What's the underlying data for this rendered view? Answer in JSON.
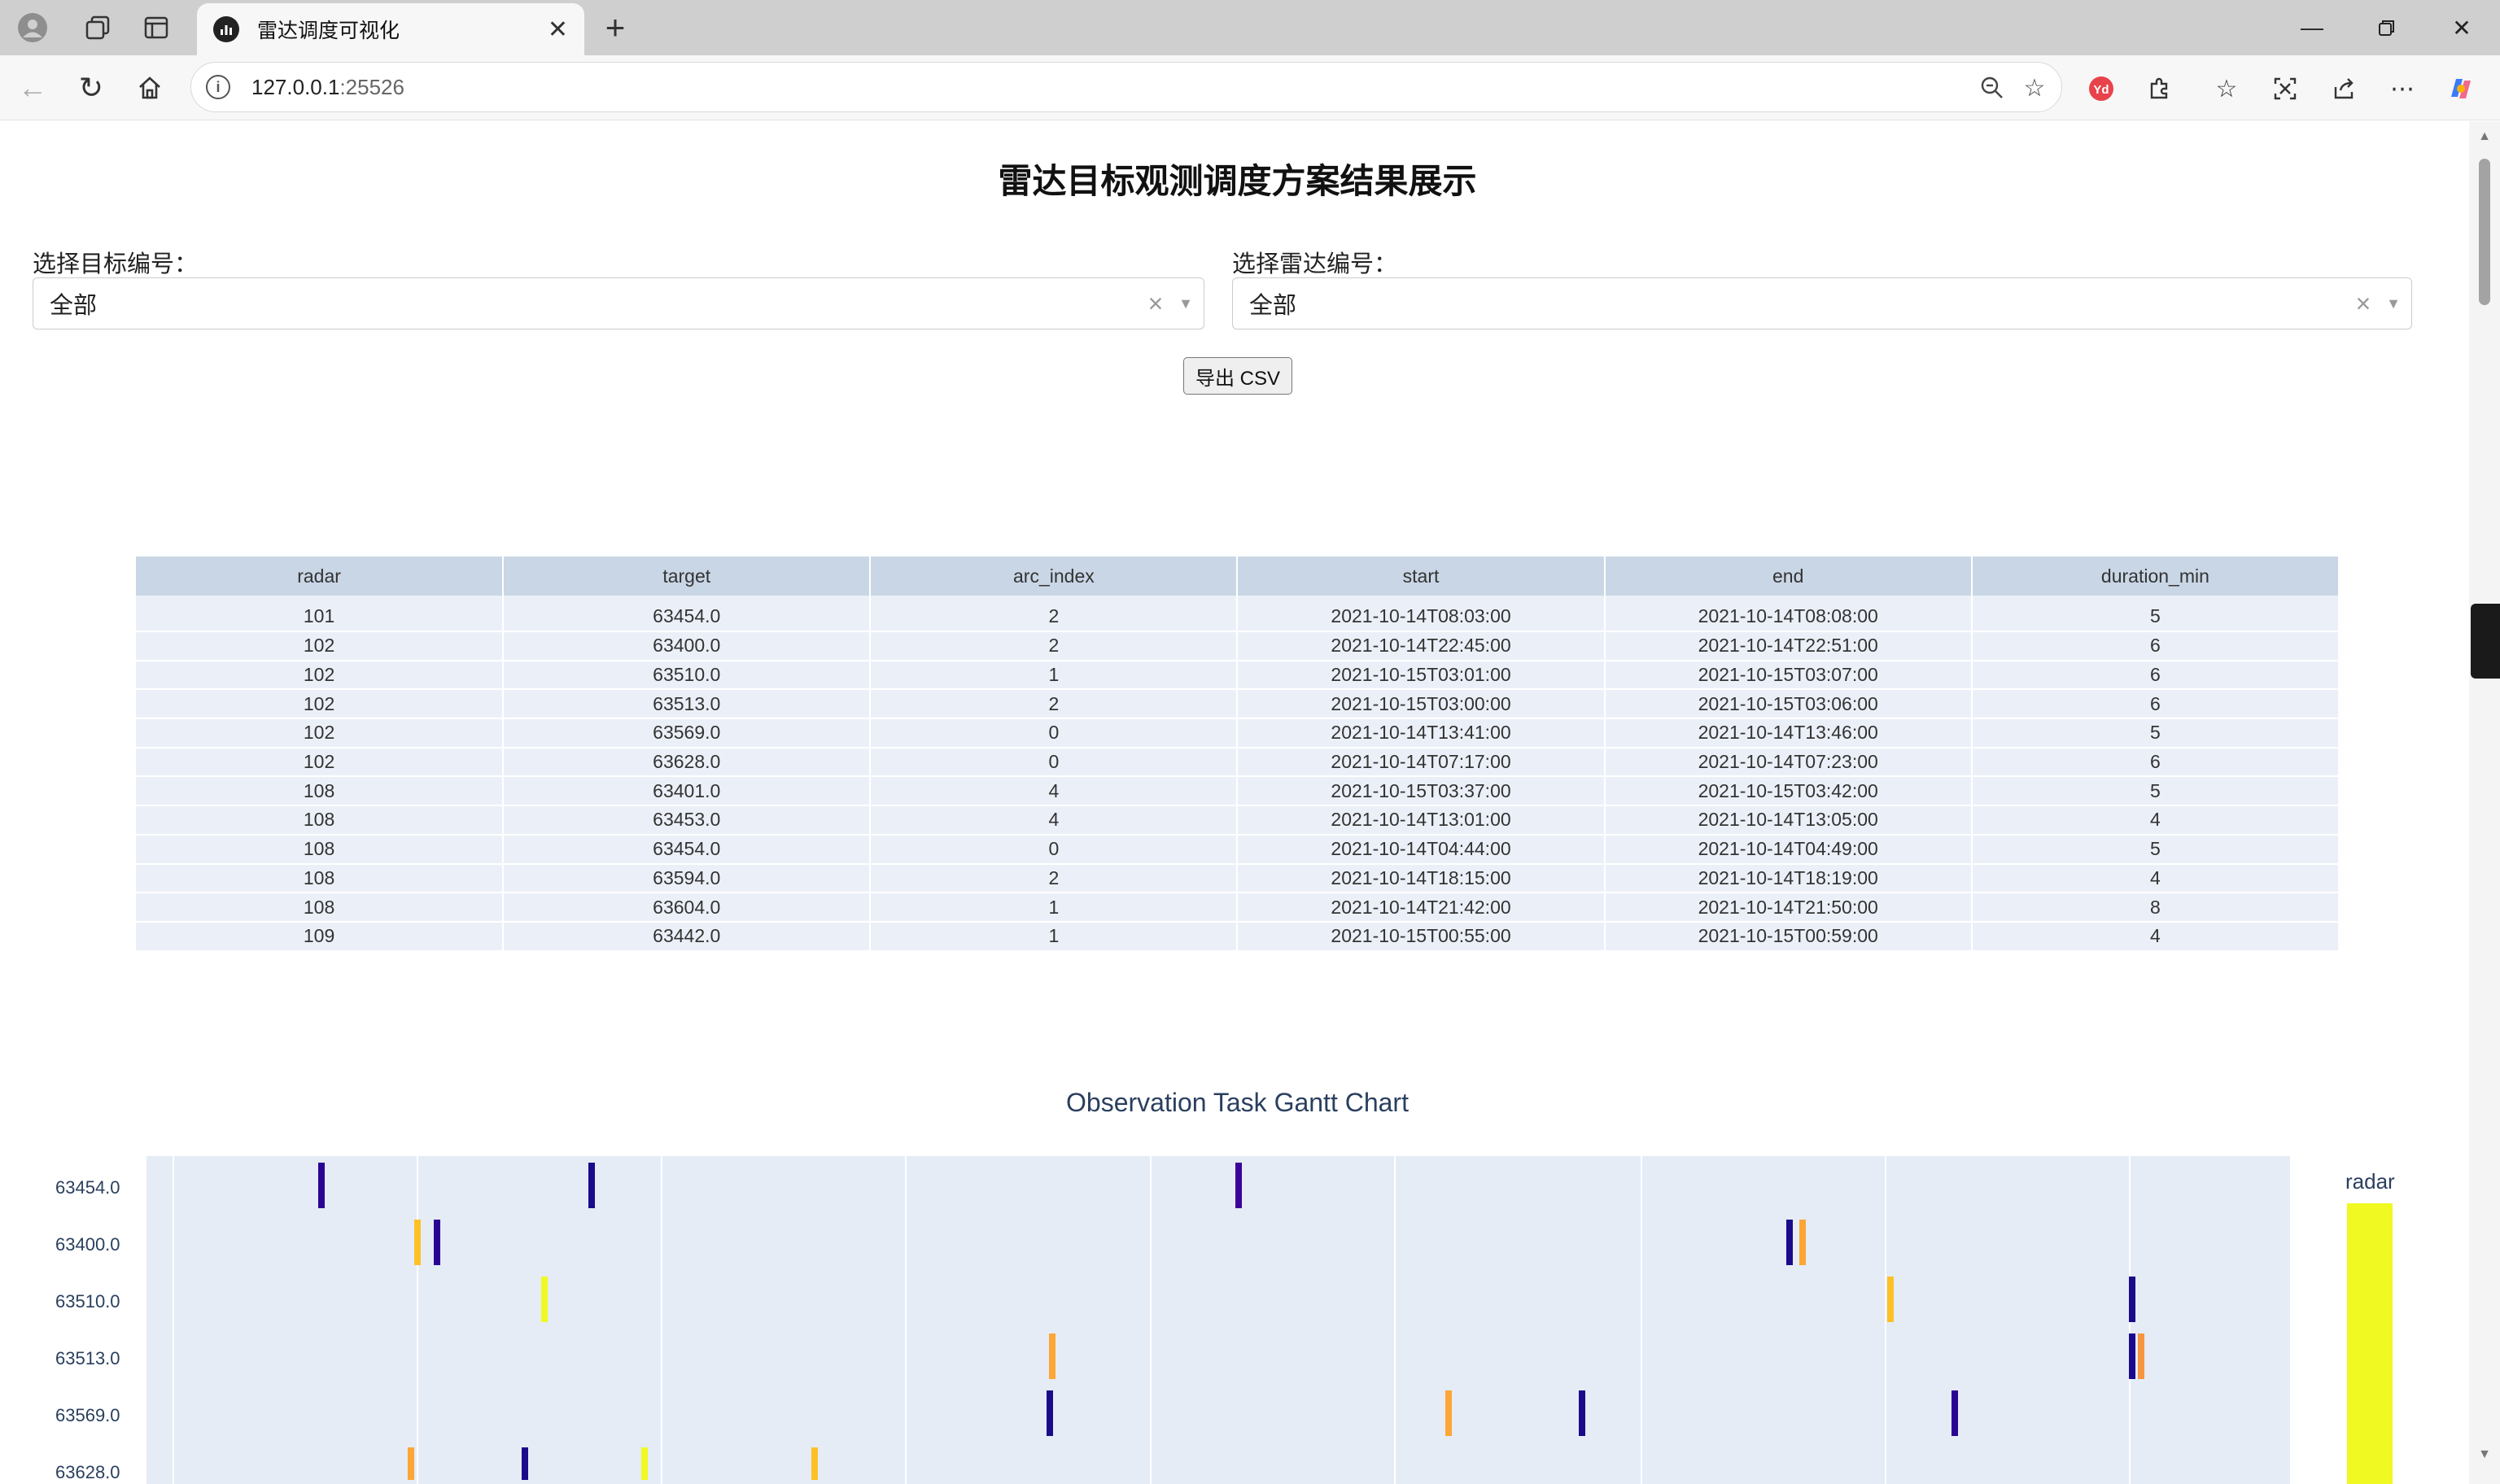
{
  "browser": {
    "tab_title": "雷达调度可视化",
    "url_host": "127.0.0.1",
    "url_port": ":25526"
  },
  "page": {
    "title": "雷达目标观测调度方案结果展示",
    "target_filter": {
      "label": "选择目标编号：",
      "value": "全部"
    },
    "radar_filter": {
      "label": "选择雷达编号：",
      "value": "全部"
    },
    "export_label": "导出 CSV"
  },
  "table": {
    "columns": [
      "radar",
      "target",
      "arc_index",
      "start",
      "end",
      "duration_min"
    ],
    "rows": [
      [
        "101",
        "63454.0",
        "2",
        "2021-10-14T08:03:00",
        "2021-10-14T08:08:00",
        "5"
      ],
      [
        "102",
        "63400.0",
        "2",
        "2021-10-14T22:45:00",
        "2021-10-14T22:51:00",
        "6"
      ],
      [
        "102",
        "63510.0",
        "1",
        "2021-10-15T03:01:00",
        "2021-10-15T03:07:00",
        "6"
      ],
      [
        "102",
        "63513.0",
        "2",
        "2021-10-15T03:00:00",
        "2021-10-15T03:06:00",
        "6"
      ],
      [
        "102",
        "63569.0",
        "0",
        "2021-10-14T13:41:00",
        "2021-10-14T13:46:00",
        "5"
      ],
      [
        "102",
        "63628.0",
        "0",
        "2021-10-14T07:17:00",
        "2021-10-14T07:23:00",
        "6"
      ],
      [
        "108",
        "63401.0",
        "4",
        "2021-10-15T03:37:00",
        "2021-10-15T03:42:00",
        "5"
      ],
      [
        "108",
        "63453.0",
        "4",
        "2021-10-14T13:01:00",
        "2021-10-14T13:05:00",
        "4"
      ],
      [
        "108",
        "63454.0",
        "0",
        "2021-10-14T04:44:00",
        "2021-10-14T04:49:00",
        "5"
      ],
      [
        "108",
        "63594.0",
        "2",
        "2021-10-14T18:15:00",
        "2021-10-14T18:19:00",
        "4"
      ],
      [
        "108",
        "63604.0",
        "1",
        "2021-10-14T21:42:00",
        "2021-10-14T21:50:00",
        "8"
      ],
      [
        "109",
        "63442.0",
        "1",
        "2021-10-15T00:55:00",
        "2021-10-15T00:59:00",
        "4"
      ]
    ]
  },
  "chart_data": {
    "type": "gantt",
    "title": "Observation Task Gantt Chart",
    "y_categories": [
      "63454.0",
      "63400.0",
      "63510.0",
      "63513.0",
      "63569.0",
      "63628.0"
    ],
    "color_legend_title": "radar",
    "colors": {
      "low": "#0d0887",
      "mid": "#7e03a8",
      "high_mid": "#f89540",
      "orange": "#fca636",
      "high": "#f0f921"
    },
    "bars": [
      {
        "row": 0,
        "x": 0.08,
        "color": "#2a0593"
      },
      {
        "row": 0,
        "x": 0.206,
        "color": "#1b0a8a"
      },
      {
        "row": 0,
        "x": 0.508,
        "color": "#3c049b"
      },
      {
        "row": 1,
        "x": 0.125,
        "color": "#fdc127"
      },
      {
        "row": 1,
        "x": 0.134,
        "color": "#2a0593"
      },
      {
        "row": 1,
        "x": 0.765,
        "color": "#1b0a8a"
      },
      {
        "row": 1,
        "x": 0.771,
        "color": "#fca636"
      },
      {
        "row": 2,
        "x": 0.184,
        "color": "#f0f921"
      },
      {
        "row": 2,
        "x": 0.812,
        "color": "#fdc127"
      },
      {
        "row": 2,
        "x": 0.925,
        "color": "#1b0a8a"
      },
      {
        "row": 3,
        "x": 0.421,
        "color": "#fca636"
      },
      {
        "row": 3,
        "x": 0.925,
        "color": "#1b0a8a"
      },
      {
        "row": 3,
        "x": 0.929,
        "color": "#f89540"
      },
      {
        "row": 4,
        "x": 0.42,
        "color": "#1b0a8a"
      },
      {
        "row": 4,
        "x": 0.606,
        "color": "#fca636"
      },
      {
        "row": 4,
        "x": 0.668,
        "color": "#1b0a8a"
      },
      {
        "row": 4,
        "x": 0.842,
        "color": "#2a0593"
      },
      {
        "row": 5,
        "x": 0.122,
        "color": "#fca636"
      },
      {
        "row": 5,
        "x": 0.175,
        "color": "#1b0a8a"
      },
      {
        "row": 5,
        "x": 0.231,
        "color": "#f0f921"
      },
      {
        "row": 5,
        "x": 0.31,
        "color": "#fdc127"
      }
    ],
    "grid_x": [
      0.012,
      0.126,
      0.24,
      0.354,
      0.468,
      0.582,
      0.697,
      0.811,
      0.925
    ]
  }
}
